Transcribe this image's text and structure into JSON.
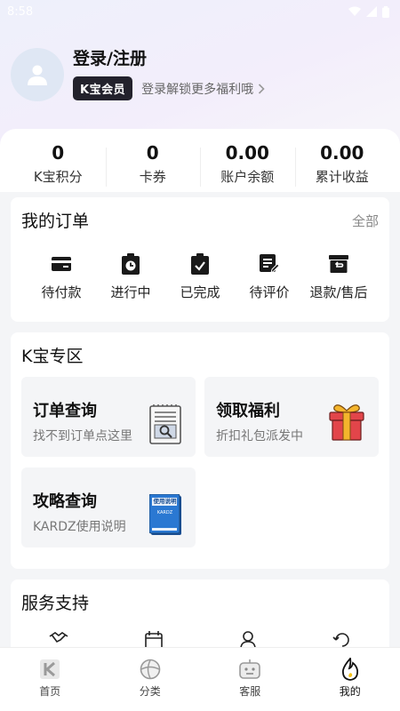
{
  "status_bar": {
    "time": "8:58"
  },
  "profile": {
    "title": "登录/注册",
    "vip_badge": "K宝会员",
    "member_text": "登录解锁更多福利哦"
  },
  "stats": [
    {
      "value": "0",
      "label": "K宝积分"
    },
    {
      "value": "0",
      "label": "卡券"
    },
    {
      "value": "0.00",
      "label": "账户余额"
    },
    {
      "value": "0.00",
      "label": "累计收益"
    }
  ],
  "orders": {
    "title": "我的订单",
    "link": "全部",
    "items": [
      {
        "label": "待付款",
        "icon": "wallet-icon"
      },
      {
        "label": "进行中",
        "icon": "clock-clipboard-icon"
      },
      {
        "label": "已完成",
        "icon": "check-clipboard-icon"
      },
      {
        "label": "待评价",
        "icon": "review-edit-icon"
      },
      {
        "label": "退款/售后",
        "icon": "refund-box-icon"
      }
    ]
  },
  "kbao_zone": {
    "title": "K宝专区",
    "tiles": [
      {
        "title": "订单查询",
        "subtitle": "找不到订单点这里",
        "icon": "search-document-icon"
      },
      {
        "title": "领取福利",
        "subtitle": "折扣礼包派发中",
        "icon": "gift-icon"
      },
      {
        "title": "攻略查询",
        "subtitle": "KARDZ使用说明",
        "icon": "manual-book-icon"
      }
    ],
    "manual_cover": "使用说明",
    "manual_brand": "KARDZ"
  },
  "service": {
    "title": "服务支持"
  },
  "tabbar": [
    {
      "label": "首页",
      "icon": "home-k-logo-icon"
    },
    {
      "label": "分类",
      "icon": "category-ball-icon"
    },
    {
      "label": "客服",
      "icon": "robot-service-icon"
    },
    {
      "label": "我的",
      "icon": "flame-profile-icon",
      "active": true
    }
  ],
  "colors": {
    "badge_bg": "#23222c",
    "gift_red": "#e2454a",
    "gift_gold": "#f4b52c",
    "book_blue": "#2a78d2"
  }
}
